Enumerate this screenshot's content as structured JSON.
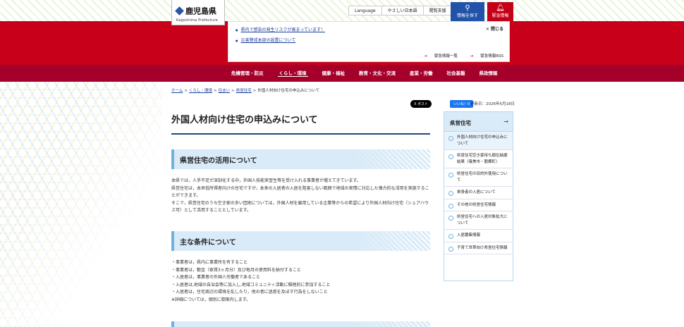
{
  "header": {
    "logo_jp": "鹿児島県",
    "logo_en": "Kagoshima Prefecture",
    "util_links": [
      "Language",
      "やさしい日本語",
      "閲覧支援"
    ],
    "search_label": "情報を探す",
    "emergency_label": "緊急情報"
  },
  "alert": {
    "items": [
      "県内で感染の発生リスクが高まっています！",
      "災害警戒本部の設置について"
    ],
    "close_label": "閉じる",
    "list_link": "緊急情報一覧",
    "rss_link": "緊急情報RSS"
  },
  "gnav": {
    "items": [
      "危機管理・防災",
      "くらし・環境",
      "健康・福祉",
      "教育・文化・交流",
      "産業・労働",
      "社会基盤",
      "県政情報"
    ]
  },
  "breadcrumb": [
    "ホーム",
    "くらし・環境",
    "住まい",
    "県営住宅",
    "外国人材向け住宅の申込みについて"
  ],
  "share": {
    "post": "X ポスト",
    "fb": "いいね！0"
  },
  "updated": "更新日：2026年5月18日",
  "main": {
    "title": "外国人材向け住宅の申込みについて",
    "section1_title": "県営住宅の活用について",
    "section1_paras": [
      "本県では，人手不足が深刻化する中，外国人技能実習生等を受け入れる事業者が増えてきています。",
      "県営住宅は，本来低所得者向けの住宅ですが，本来の入居者の入居を阻害しない範囲で地域の実情に対応した弾力的な活用を実施することができます。",
      "そこで，県営住宅のうち空き家の多い団地については，外国人材を雇用している企業等からの希望により外国人材向け住宅（シェアハウス可）として活用することとしています。"
    ],
    "section2_title": "主な条件について",
    "section2_items": [
      "・事業者は，県内に事業所を有すること",
      "・事業者は，敷金（家賃3ヶ月分）及び毎月の使用料を納付すること",
      "・入居者は，事業者の外国人労働者であること",
      "・入居者は,地域の自治会等に加入し,地域コミュニティ活動に積極的に参加すること",
      "・入居者は，住宅周辺の環境を乱したり，他の者に迷惑を及ぼす行為をしないこと",
      "※詳細については，個別に御案内します。"
    ]
  },
  "sidebar": {
    "title": "県営住宅",
    "items": [
      "外国人材向け住宅の申込みについて",
      "県営住宅空き家待ち順位抽選結果（奄美市・龍郷町）",
      "県営住宅の目的外使用について",
      "単身者の入居について",
      "その他の県営住宅情報",
      "県営住宅への入居対象拡大について",
      "入居募集情報",
      "子育て世帯向け県営住宅情報"
    ]
  }
}
